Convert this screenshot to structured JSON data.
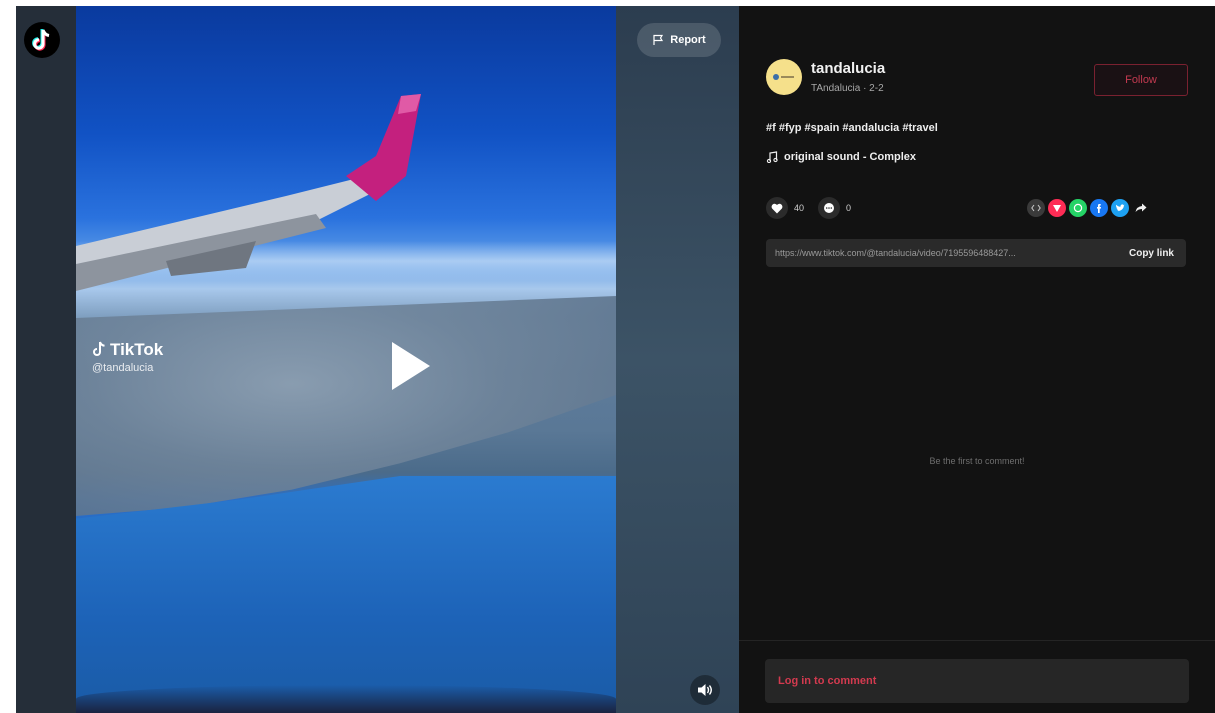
{
  "video": {
    "watermark_brand": "TikTok",
    "watermark_user": "@tandalucia",
    "report_label": "Report"
  },
  "author": {
    "username": "tandalucia",
    "subline": "TAndalucia · 2-2",
    "follow_label": "Follow"
  },
  "post": {
    "caption": "#f #fyp #spain #andalucia #travel",
    "sound": "original sound - Complex",
    "likes": "40",
    "comments": "0"
  },
  "share": {
    "link": "https://www.tiktok.com/@tandalucia/video/7195596488427...",
    "copy_label": "Copy link",
    "icons": [
      "embed-icon",
      "pinterest-icon",
      "whatsapp-icon",
      "facebook-icon",
      "twitter-icon",
      "share-arrow-icon"
    ]
  },
  "comments": {
    "empty_text": "Be the first to comment!",
    "login_label": "Log in to comment"
  },
  "colors": {
    "panel_bg": "#121212",
    "accent_red": "#d33a4f",
    "avatar_bg": "#f5e08b"
  }
}
